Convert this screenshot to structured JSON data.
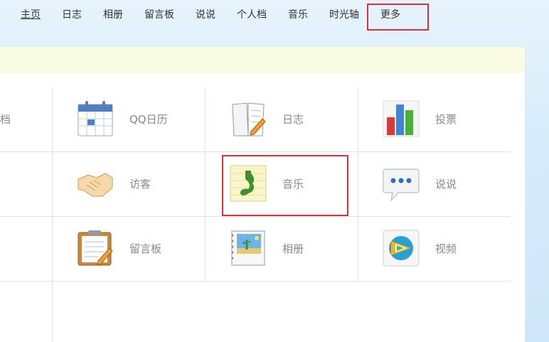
{
  "nav": {
    "items": [
      {
        "label": "主页"
      },
      {
        "label": "日志"
      },
      {
        "label": "相册"
      },
      {
        "label": "留言板"
      },
      {
        "label": "说说"
      },
      {
        "label": "个人档"
      },
      {
        "label": "音乐"
      },
      {
        "label": "时光轴"
      },
      {
        "label": "更多"
      }
    ]
  },
  "apps": {
    "partial_label": "档",
    "items": [
      {
        "label": "QQ日历",
        "icon": "calendar-icon"
      },
      {
        "label": "日志",
        "icon": "notebook-icon"
      },
      {
        "label": "投票",
        "icon": "bar-chart-icon"
      },
      {
        "label": "访客",
        "icon": "handshake-icon"
      },
      {
        "label": "音乐",
        "icon": "music-note-icon"
      },
      {
        "label": "说说",
        "icon": "speech-bubble-icon"
      },
      {
        "label": "留言板",
        "icon": "clipboard-icon"
      },
      {
        "label": "相册",
        "icon": "photo-album-icon"
      },
      {
        "label": "视频",
        "icon": "video-play-icon"
      }
    ]
  },
  "colors": {
    "highlight": "#d9303a",
    "notice_bar": "#fafbe3"
  }
}
